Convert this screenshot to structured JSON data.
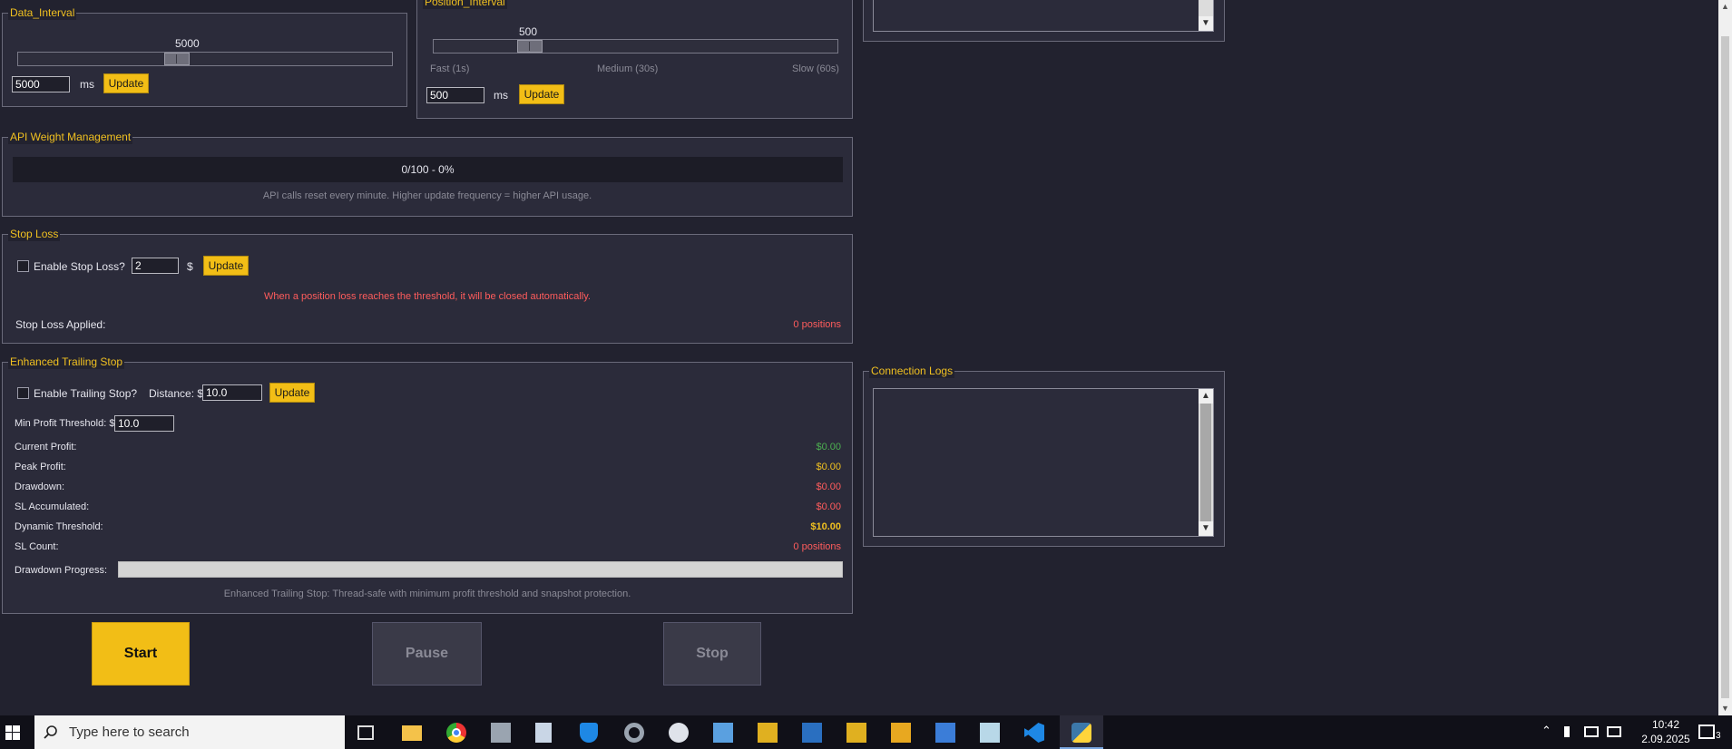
{
  "data_interval": {
    "legend": "Data_Interval",
    "slider_value": "5000",
    "slider_fraction": 0.42,
    "input_value": "5000",
    "unit": "ms",
    "update_label": "Update"
  },
  "position_interval": {
    "legend": "Position_Interval",
    "slider_value": "500",
    "slider_fraction": 0.22,
    "ticks": [
      "Fast (1s)",
      "Medium (30s)",
      "Slow (60s)"
    ],
    "input_value": "500",
    "unit": "ms",
    "update_label": "Update"
  },
  "api_weight": {
    "legend": "API Weight Management",
    "progress_text": "0/100 - 0%",
    "progress_fraction": 0,
    "note": "API calls reset every minute. Higher update frequency = higher API usage."
  },
  "stop_loss": {
    "legend": "Stop Loss",
    "enable_label": "Enable Stop Loss?",
    "input_value": "2",
    "currency": "$",
    "update_label": "Update",
    "warning": "When a position loss reaches the threshold, it will be closed automatically.",
    "applied_label": "Stop Loss Applied:",
    "applied_value": "0 positions"
  },
  "trailing_stop": {
    "legend": "Enhanced Trailing Stop",
    "enable_label": "Enable Trailing Stop?",
    "distance_label": "Distance: $",
    "distance_value": "10.0",
    "update_label": "Update",
    "min_profit_label": "Min Profit Threshold: $",
    "min_profit_value": "10.0",
    "stats": [
      {
        "label": "Current Profit:",
        "value": "$0.00",
        "color": "#4caf50"
      },
      {
        "label": "Peak Profit:",
        "value": "$0.00",
        "color": "#f0c020"
      },
      {
        "label": "Drawdown:",
        "value": "$0.00",
        "color": "#ff5c5c"
      },
      {
        "label": "SL Accumulated:",
        "value": "$0.00",
        "color": "#ff5c5c"
      },
      {
        "label": "Dynamic Threshold:",
        "value": "$10.00",
        "color": "#f0c020"
      },
      {
        "label": "SL Count:",
        "value": "0 positions",
        "color": "#ff5c5c"
      }
    ],
    "drawdown_label": "Drawdown Progress:",
    "drawdown_fraction": 0,
    "note": "Enhanced Trailing Stop: Thread-safe with minimum profit threshold and snapshot protection."
  },
  "connection_logs": {
    "legend": "Connection Logs"
  },
  "controls": {
    "start": "Start",
    "pause": "Pause",
    "stop": "Stop"
  },
  "taskbar": {
    "search_placeholder": "Type here to search",
    "time": "10:42",
    "date": "2.09.2025",
    "notification_count": "3"
  }
}
